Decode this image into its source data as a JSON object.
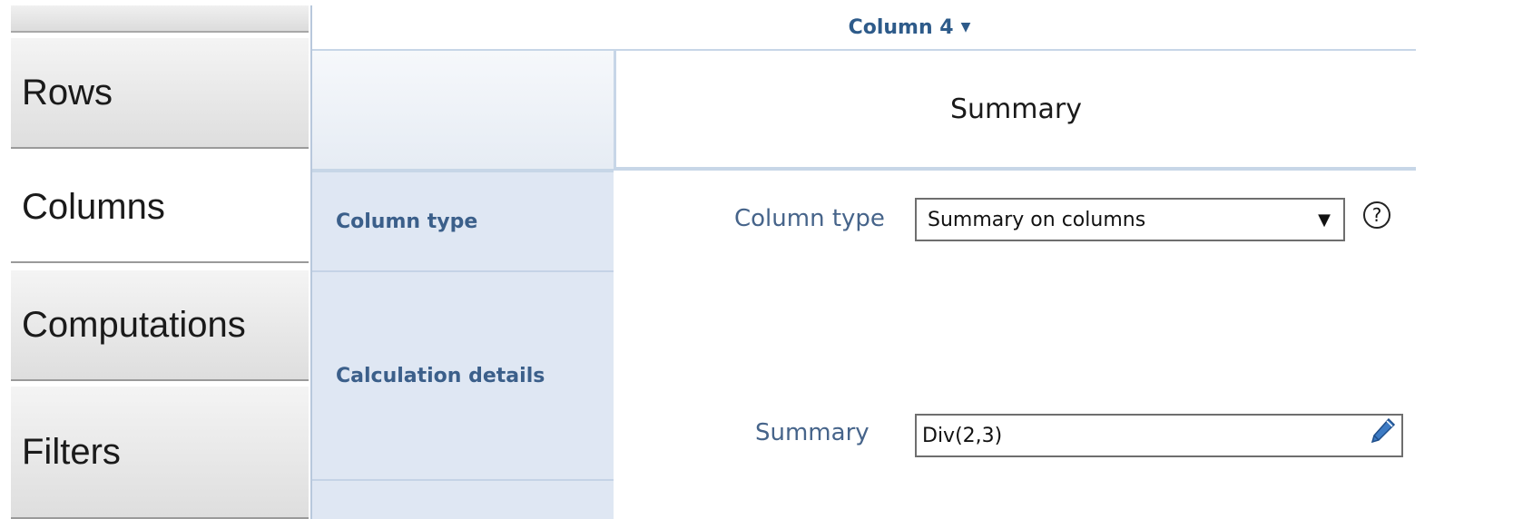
{
  "tabs": {
    "rows": "Rows",
    "columns": "Columns",
    "computations": "Computations",
    "filters": "Filters"
  },
  "column_header": {
    "title": "Column 4",
    "caret": "▼"
  },
  "summary_heading": "Summary",
  "row_labels": {
    "column_type": "Column type",
    "calculation_details": "Calculation details"
  },
  "fields": {
    "column_type_label": "Column type",
    "column_type_value": "Summary on columns",
    "select_arrow": "▼",
    "help": "?",
    "summary_label": "Summary",
    "summary_value": "Div(2,3)"
  },
  "icons": {
    "help": "help-icon",
    "edit": "pencil-icon"
  },
  "colors": {
    "accent": "#2e5b8a",
    "label_band": "#dfe7f3",
    "border": "#c7d6e7"
  }
}
